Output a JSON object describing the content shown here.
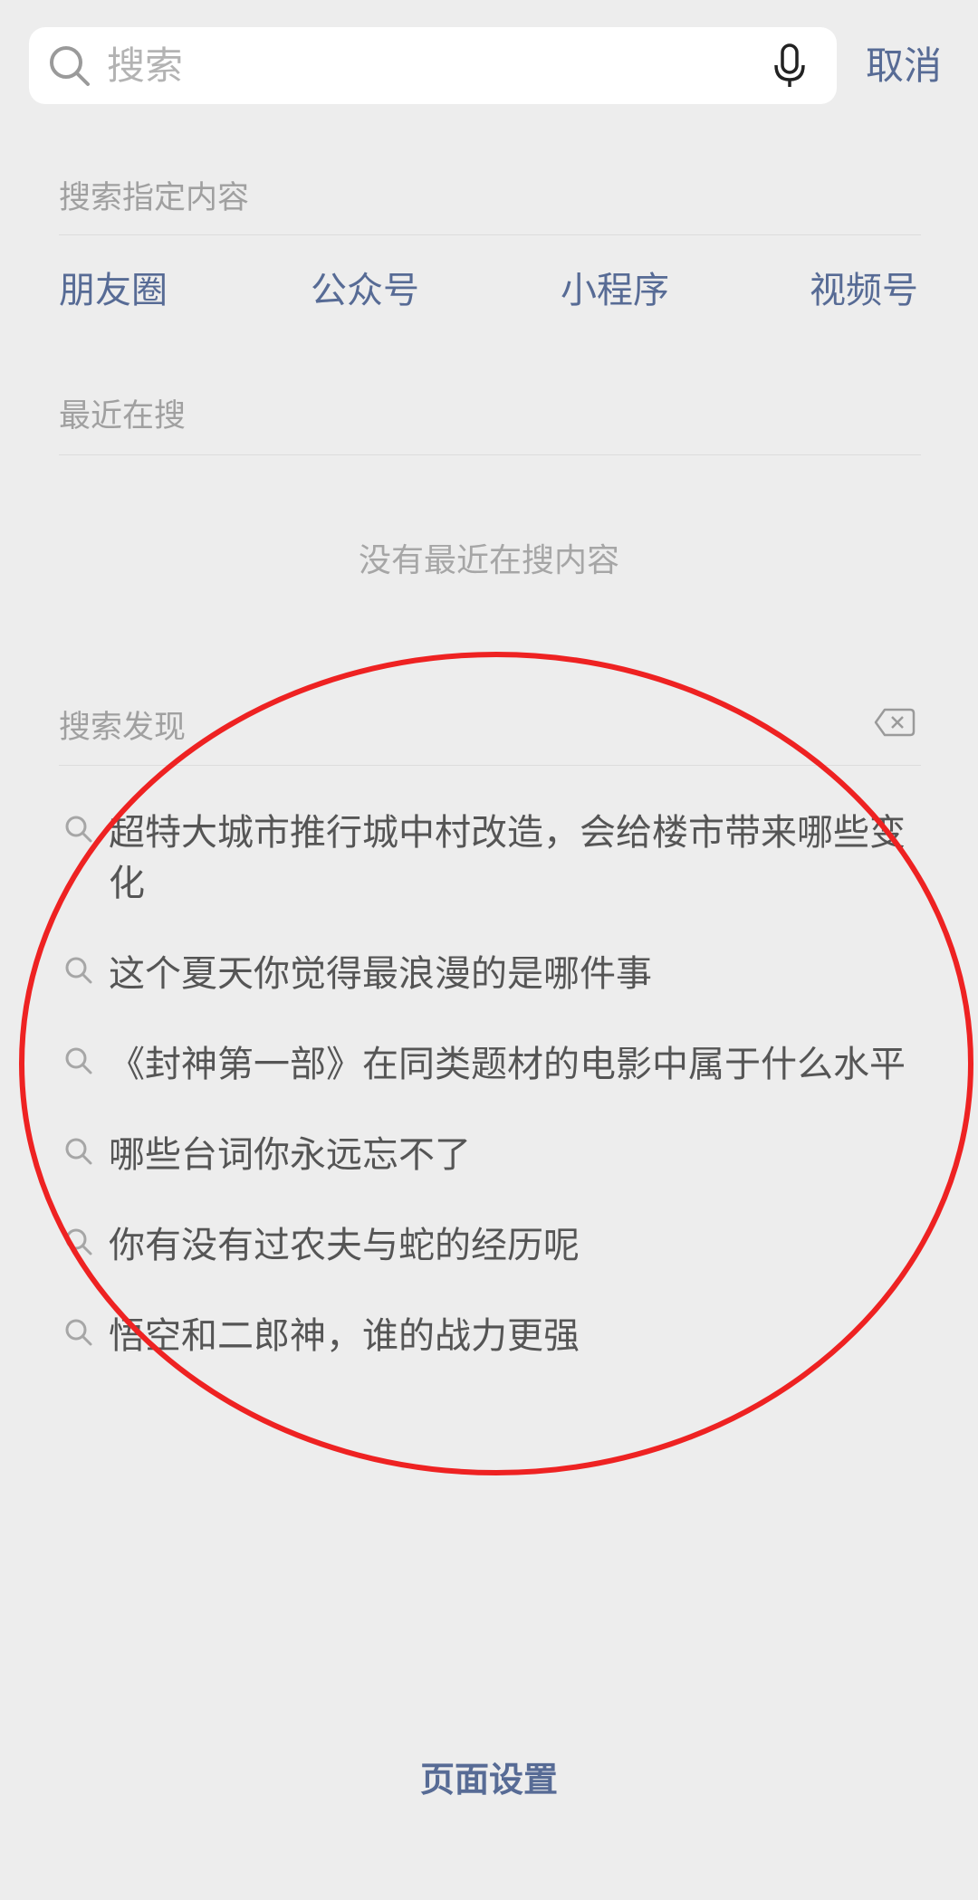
{
  "search": {
    "placeholder": "搜索",
    "cancel_label": "取消"
  },
  "specific": {
    "title": "搜索指定内容",
    "categories": [
      "朋友圈",
      "公众号",
      "小程序",
      "视频号"
    ]
  },
  "recent": {
    "title": "最近在搜",
    "empty_text": "没有最近在搜内容"
  },
  "discover": {
    "title": "搜索发现",
    "items": [
      "超特大城市推行城中村改造，会给楼市带来哪些变化",
      "这个夏天你觉得最浪漫的是哪件事",
      "《封神第一部》在同类题材的电影中属于什么水平",
      "哪些台词你永远忘不了",
      "你有没有过农夫与蛇的经历呢",
      "悟空和二郎神，谁的战力更强"
    ]
  },
  "footer": {
    "settings_label": "页面设置"
  },
  "colors": {
    "link": "#576b95",
    "background": "#ededed",
    "annotation": "#ee2222"
  },
  "icons": [
    "search-icon",
    "microphone-icon",
    "clear-icon",
    "search-item-icon"
  ]
}
